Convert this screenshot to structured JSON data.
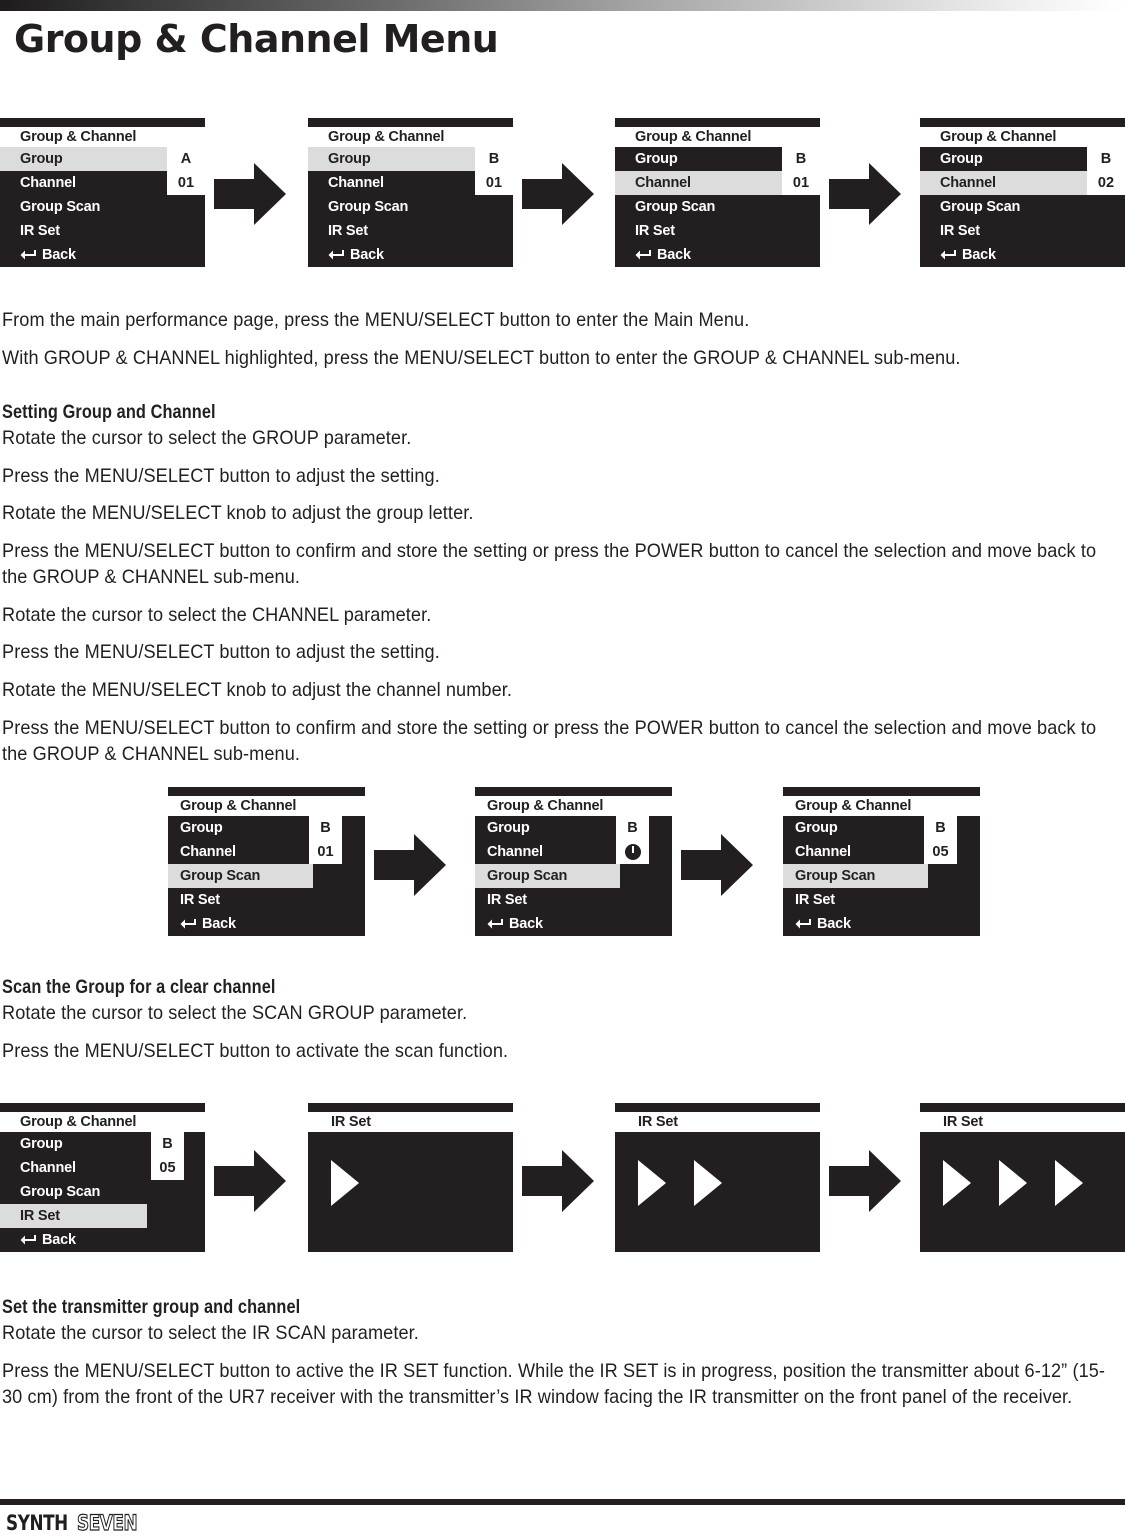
{
  "page": {
    "title": "Group & Channel Menu"
  },
  "labels": {
    "group": "Group",
    "channel": "Channel",
    "group_scan": "Group Scan",
    "ir_set": "IR Set",
    "back": "Back",
    "screen_title_gc": "Group & Channel",
    "screen_title_ir": "IR Set"
  },
  "screens": {
    "row1": [
      {
        "title": "Group & Channel",
        "group": "A",
        "channel": "01",
        "highlight": "group"
      },
      {
        "title": "Group & Channel",
        "group": "B",
        "channel": "01",
        "highlight": "group"
      },
      {
        "title": "Group & Channel",
        "group": "B",
        "channel": "01",
        "highlight": "channel"
      },
      {
        "title": "Group & Channel",
        "group": "B",
        "channel": "02",
        "highlight": "channel"
      }
    ],
    "row2": [
      {
        "title": "Group & Channel",
        "group": "B",
        "channel": "01",
        "highlight": "group_scan"
      },
      {
        "title": "Group & Channel",
        "group": "B",
        "channel": "scanning-spinner-icon",
        "highlight": "group_scan"
      },
      {
        "title": "Group & Channel",
        "group": "B",
        "channel": "05",
        "highlight": "group_scan"
      }
    ],
    "row3": [
      {
        "title": "Group & Channel",
        "group": "B",
        "channel": "05",
        "highlight": "ir_set"
      },
      {
        "title": "IR Set",
        "progress": 1
      },
      {
        "title": "IR Set",
        "progress": 2
      },
      {
        "title": "IR Set",
        "progress": 3
      }
    ]
  },
  "body": {
    "p1": "From the main performance page, press the MENU/SELECT button to enter the Main Menu.",
    "p2": "With GROUP & CHANNEL highlighted, press the MENU/SELECT button to enter the GROUP & CHANNEL sub-menu.",
    "h1": "Setting Group and Channel",
    "p3": "Rotate the cursor to select the GROUP parameter.",
    "p4": "Press the MENU/SELECT button to adjust the setting.",
    "p5": "Rotate the MENU/SELECT knob to adjust the group letter.",
    "p6": "Press the MENU/SELECT button to confirm and store the setting or press the POWER button to cancel the selection and move back to the GROUP & CHANNEL sub-menu.",
    "p7": "Rotate the cursor to select the CHANNEL parameter.",
    "p8": "Press the MENU/SELECT button to adjust the setting.",
    "p9": "Rotate the MENU/SELECT knob to adjust the channel number.",
    "p10": "Press the MENU/SELECT button to confirm and store the setting or press the POWER button to cancel the selection and move back to the GROUP & CHANNEL sub-menu.",
    "h2": "Scan the Group for a clear channel",
    "p11": "Rotate the cursor to select the SCAN GROUP parameter.",
    "p12": "Press the MENU/SELECT button to activate the scan function.",
    "h3": "Set the transmitter group and channel",
    "p13": "Rotate the cursor to select the IR SCAN parameter.",
    "p14": "Press the MENU/SELECT button to active the IR SET function. While the IR SET is in progress, position the transmitter about 6-12” (15-30 cm) from the front of the UR7 receiver with the transmitter’s IR window facing the IR transmitter on the front panel of the receiver."
  },
  "footer": {
    "logo_primary": "SYNTH",
    "logo_secondary": "SEVEN"
  },
  "colors": {
    "ink": "#231f20",
    "screen_bg": "#231f20",
    "highlight_bg": "#dcdcdc",
    "value_bg": "#ffffff"
  }
}
